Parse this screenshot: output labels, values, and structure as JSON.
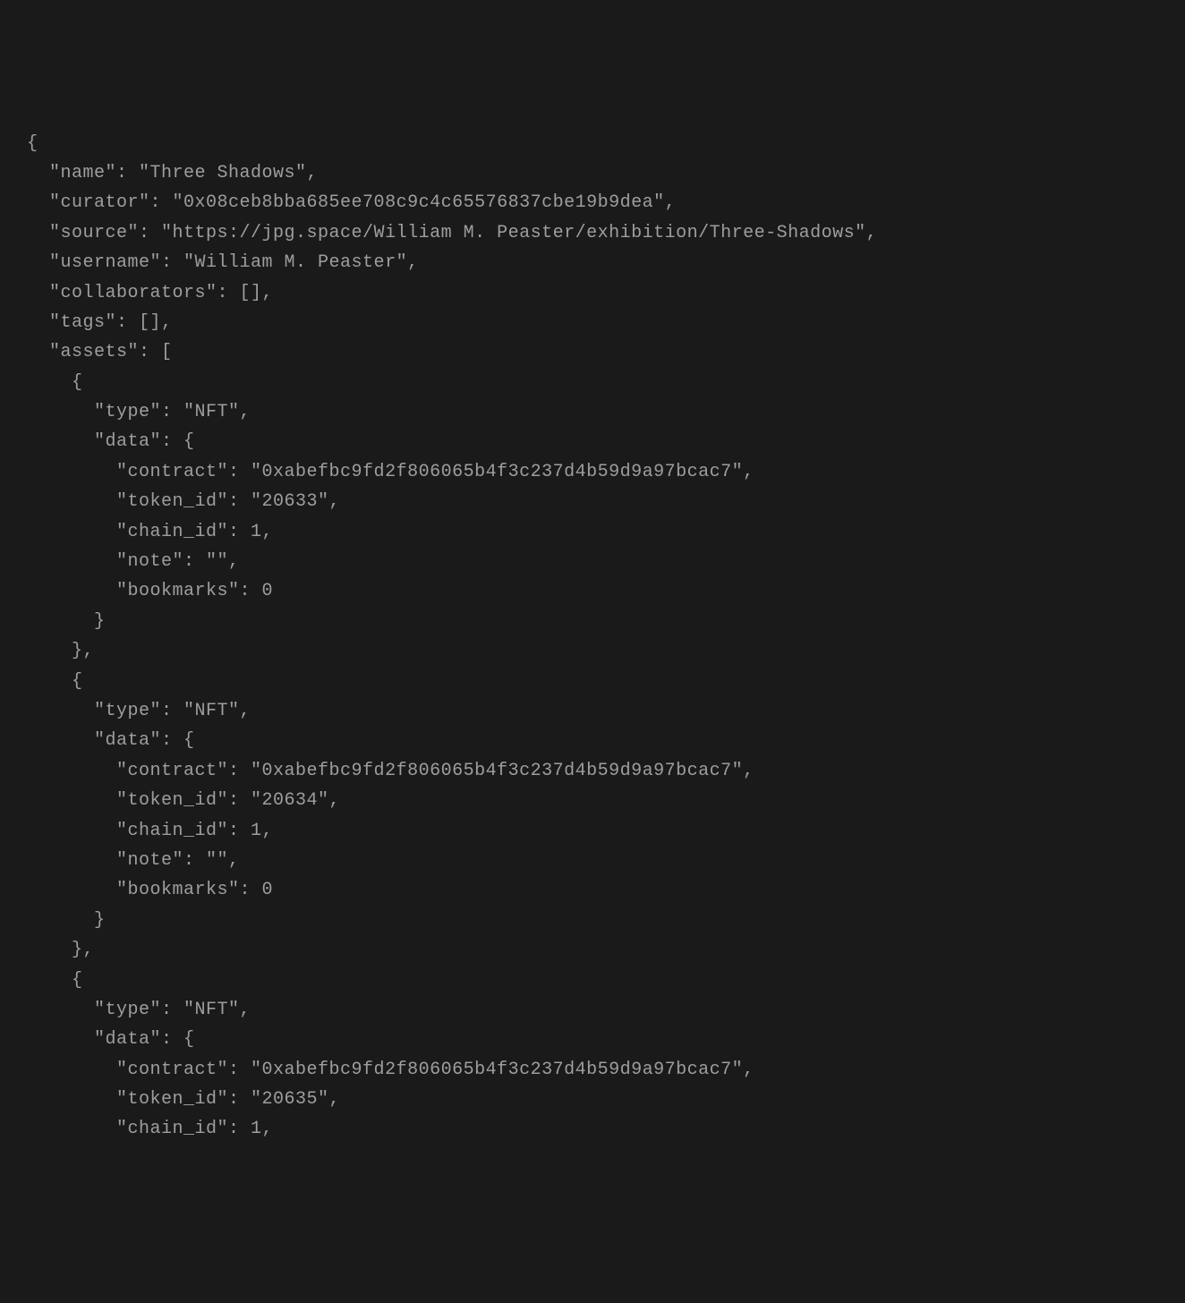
{
  "json_content": {
    "name": "Three Shadows",
    "curator": "0x08ceb8bba685ee708c9c4c65576837cbe19b9dea",
    "source": "https://jpg.space/William M. Peaster/exhibition/Three-Shadows",
    "username": "William M. Peaster",
    "collaborators": [],
    "tags": [],
    "assets": [
      {
        "type": "NFT",
        "data": {
          "contract": "0xabefbc9fd2f806065b4f3c237d4b59d9a97bcac7",
          "token_id": "20633",
          "chain_id": 1,
          "note": "",
          "bookmarks": 0
        }
      },
      {
        "type": "NFT",
        "data": {
          "contract": "0xabefbc9fd2f806065b4f3c237d4b59d9a97bcac7",
          "token_id": "20634",
          "chain_id": 1,
          "note": "",
          "bookmarks": 0
        }
      },
      {
        "type": "NFT",
        "data": {
          "contract": "0xabefbc9fd2f806065b4f3c237d4b59d9a97bcac7",
          "token_id": "20635",
          "chain_id": 1
        }
      }
    ]
  }
}
